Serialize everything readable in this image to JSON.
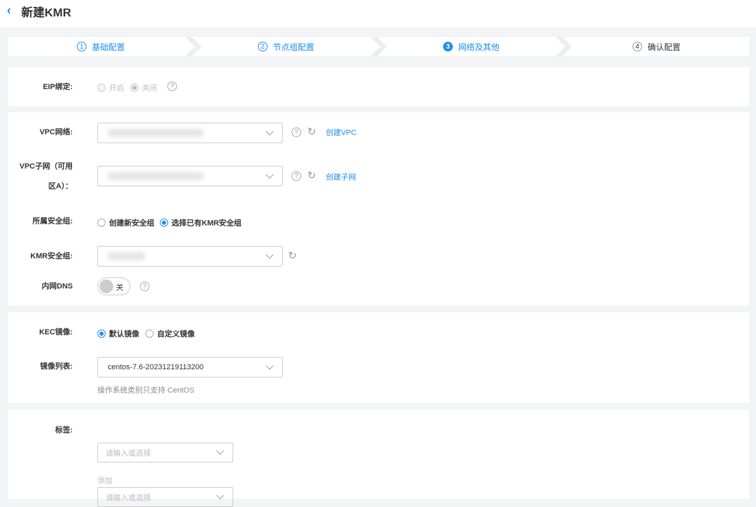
{
  "header": {
    "back_icon": "chevron-left",
    "title": "新建KMR"
  },
  "steps": [
    {
      "num": "1",
      "label": "基础配置",
      "state": "done"
    },
    {
      "num": "2",
      "label": "节点组配置",
      "state": "done"
    },
    {
      "num": "3",
      "label": "网络及其他",
      "state": "active"
    },
    {
      "num": "4",
      "label": "确认配置",
      "state": "todo"
    }
  ],
  "eip": {
    "label": "EIP绑定:",
    "options": [
      "开启",
      "关闭"
    ],
    "selected": "关闭",
    "disabled": true
  },
  "vpc": {
    "label": "VPC网络:",
    "create_link": "创建VPC"
  },
  "subnet": {
    "label_line1": "VPC子网（可用",
    "label_line2": "区A）：",
    "create_link": "创建子网"
  },
  "secgroup": {
    "label": "所属安全组:",
    "options": [
      "创建新安全组",
      "选择已有KMR安全组"
    ],
    "selected": "选择已有KMR安全组"
  },
  "kmr_secgroup": {
    "label": "KMR安全组:"
  },
  "dns": {
    "label": "内网DNS",
    "toggle_text": "关",
    "enabled": false
  },
  "kec": {
    "label": "KEC镜像:",
    "options": [
      "默认镜像",
      "自定义镜像"
    ],
    "selected": "默认镜像"
  },
  "image_list": {
    "label": "镜像列表:",
    "value": "centos-7.6-20231219113200",
    "hint": "操作系统类别只支持 CentOS"
  },
  "tags": {
    "label": "标签:",
    "placeholder": "请输入或选择",
    "add": "添加"
  }
}
